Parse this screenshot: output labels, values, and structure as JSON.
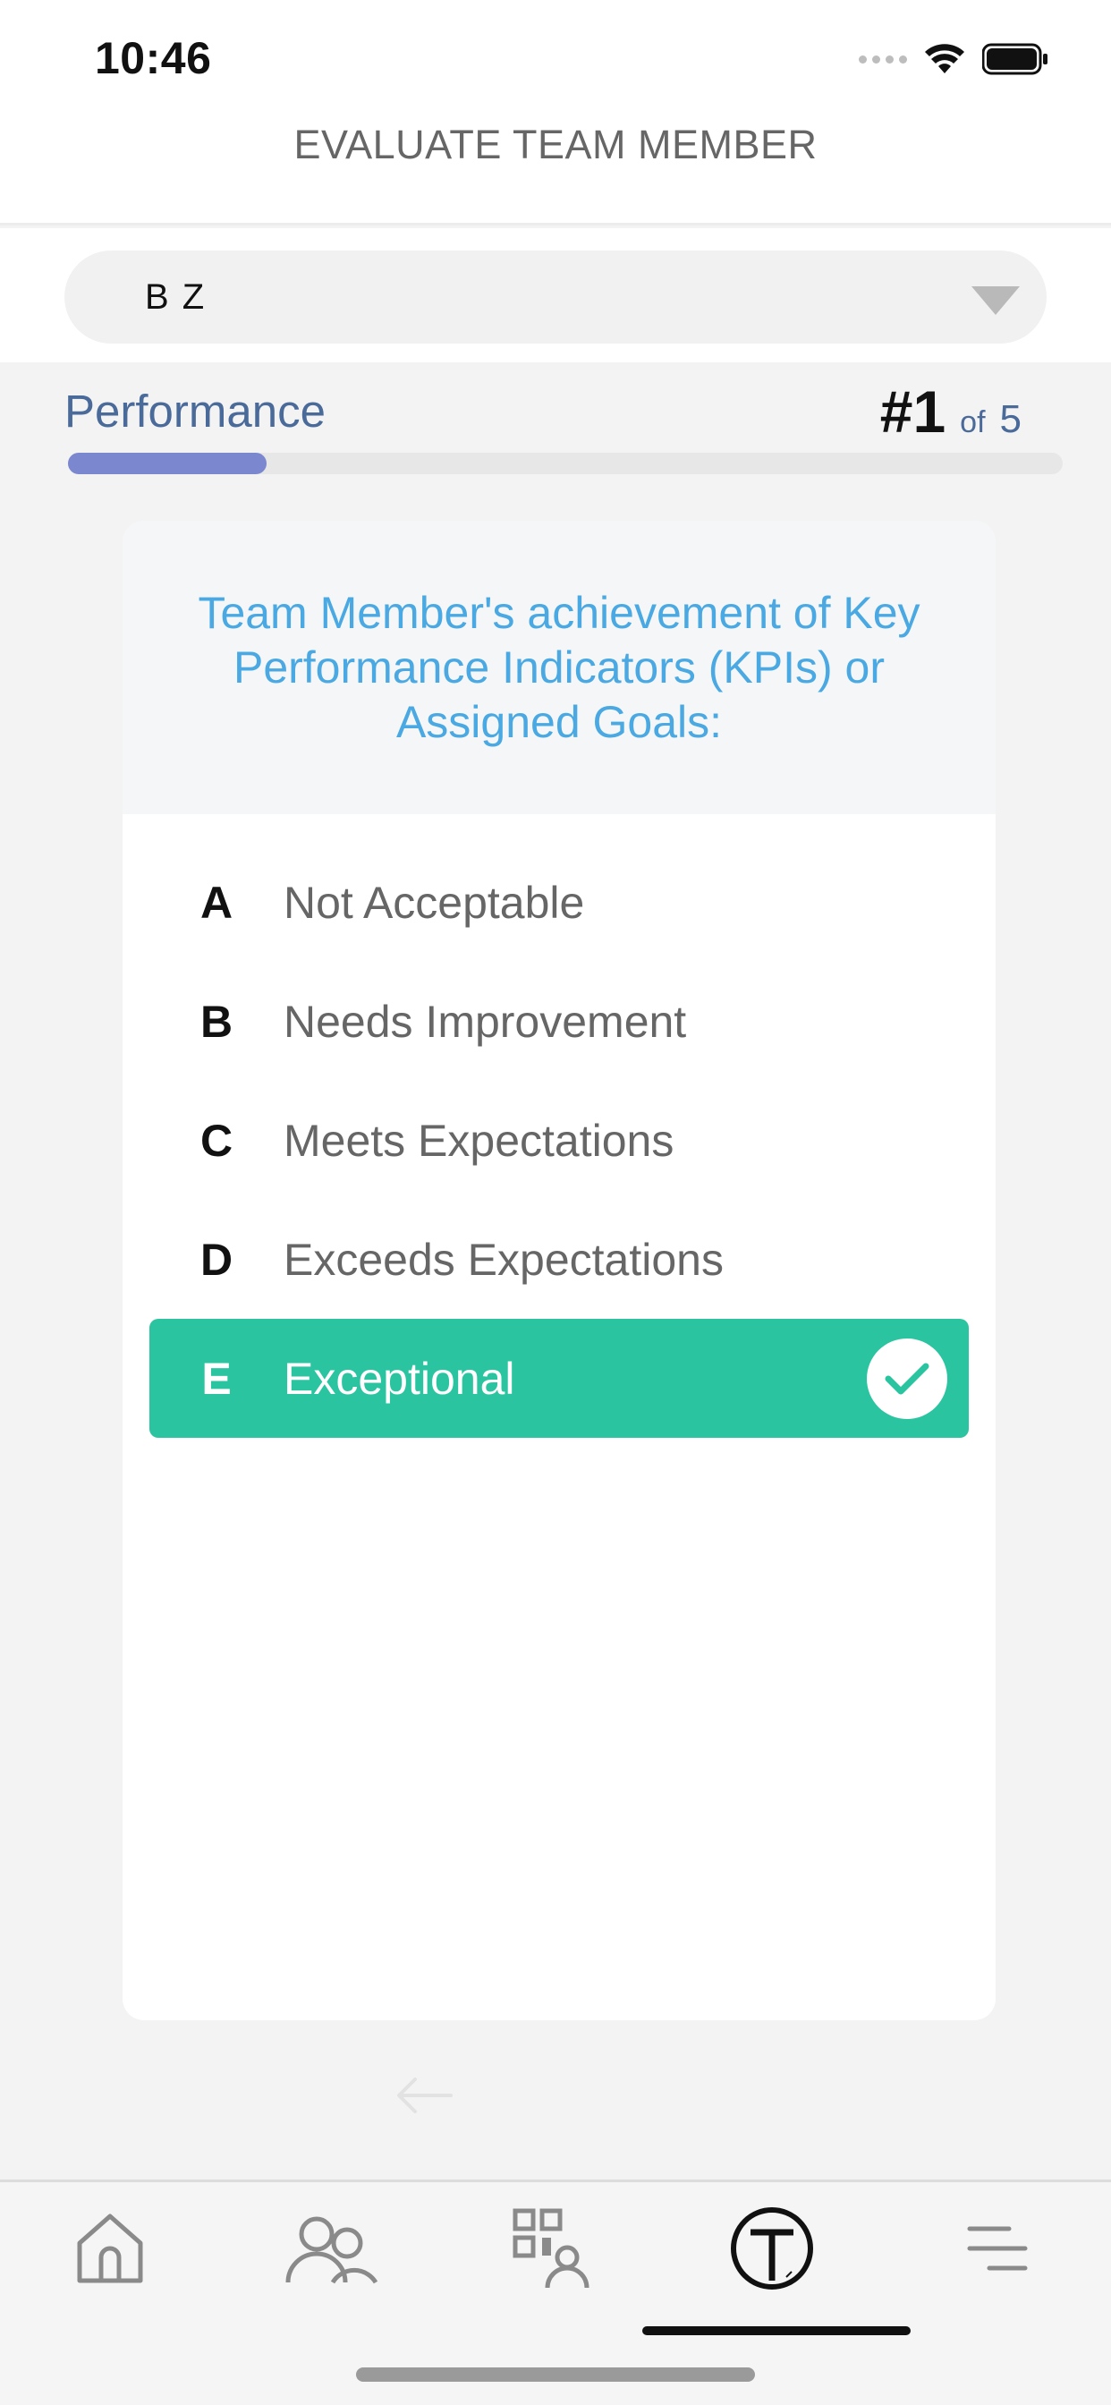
{
  "status_bar": {
    "time": "10:46"
  },
  "header": {
    "title": "EVALUATE TEAM MEMBER"
  },
  "selector": {
    "value": "B Z"
  },
  "section": {
    "label": "Performance",
    "current_number": "#1",
    "of_label": "of",
    "total": "5",
    "progress_fraction": 0.2
  },
  "question": {
    "text": "Team Member's achievement of Key Performance Indicators (KPIs) or Assigned Goals:"
  },
  "options": [
    {
      "letter": "A",
      "label": "Not Acceptable",
      "selected": false
    },
    {
      "letter": "B",
      "label": "Needs Improvement",
      "selected": false
    },
    {
      "letter": "C",
      "label": "Meets Expectations",
      "selected": false
    },
    {
      "letter": "D",
      "label": "Exceeds Expectations",
      "selected": false
    },
    {
      "letter": "E",
      "label": "Exceptional",
      "selected": true
    }
  ],
  "tabbar": {
    "items": [
      {
        "icon": "home-icon",
        "active": false
      },
      {
        "icon": "team-icon",
        "active": false
      },
      {
        "icon": "qr-person-icon",
        "active": false
      },
      {
        "icon": "logo-t-icon",
        "active": true
      },
      {
        "icon": "menu-icon",
        "active": false
      }
    ]
  },
  "colors": {
    "accent_green": "#2bc4a1",
    "progress_fill": "#7b87cf",
    "question_blue": "#4aa9e2",
    "section_blue": "#4a6a9a"
  }
}
